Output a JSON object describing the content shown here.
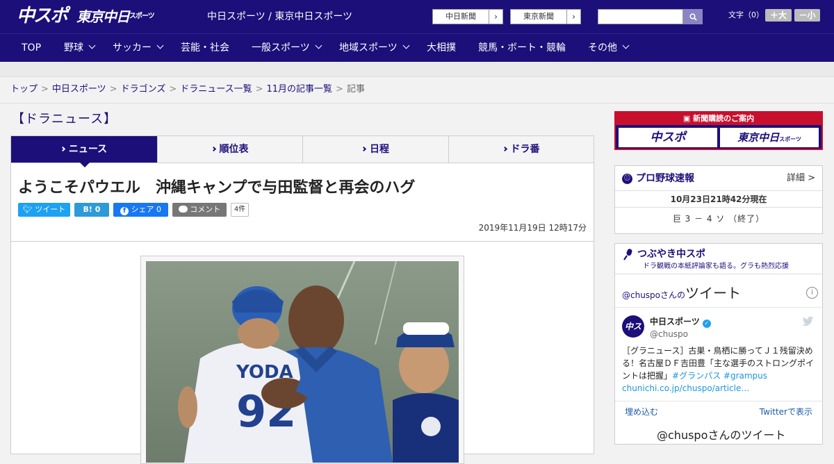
{
  "header": {
    "logo_main": "中スポ",
    "logo_tokyo": "東京中日",
    "logo_tokyo_sub": "スポーツ",
    "site_title": "中日スポーツ / 東京中日スポーツ",
    "link_chunichi": "中日新聞",
    "link_tokyo": "東京新聞",
    "search_placeholder": "",
    "font_size_label": "文字（0）",
    "font_larger": "＋大",
    "font_smaller": "－小"
  },
  "nav": {
    "items": [
      {
        "label": "TOP",
        "has_menu": false
      },
      {
        "label": "野球",
        "has_menu": true
      },
      {
        "label": "サッカー",
        "has_menu": true
      },
      {
        "label": "芸能・社会",
        "has_menu": false
      },
      {
        "label": "一般スポーツ",
        "has_menu": true
      },
      {
        "label": "地域スポーツ",
        "has_menu": true
      },
      {
        "label": "大相撲",
        "has_menu": false
      },
      {
        "label": "競馬・ボート・競輪",
        "has_menu": false
      },
      {
        "label": "その他",
        "has_menu": true
      }
    ]
  },
  "breadcrumb": {
    "items": [
      "トップ",
      "中日スポーツ",
      "ドラゴンズ",
      "ドラニュース一覧",
      "11月の記事一覧"
    ],
    "current": "記事",
    "separator": ">"
  },
  "section_title": "【ドラニュース】",
  "tabs": [
    {
      "label": "ニュース",
      "active": true
    },
    {
      "label": "順位表",
      "active": false
    },
    {
      "label": "日程",
      "active": false
    },
    {
      "label": "ドラ番",
      "active": false
    }
  ],
  "article": {
    "headline": "ようこそパウエル　沖縄キャンプで与田監督と再会のハグ",
    "date": "2019年11月19日 12時17分",
    "share": {
      "tweet": "ツイート",
      "hatena": "B!",
      "hatena_count": "0",
      "facebook": "シェア",
      "facebook_count": "0",
      "comment": "コメント",
      "comment_count": "4件"
    },
    "photo_jersey_name": "YODA",
    "photo_jersey_number": "92"
  },
  "sidebar": {
    "promo_title": "新聞購読のご案内",
    "promo_left": "中スポ",
    "promo_right": "東京中日",
    "promo_right_sub": "スポーツ",
    "score": {
      "title": "プロ野球速報",
      "detail": "詳細 >",
      "time": "10月23日21時42分現在",
      "line": "巨 3 － 4 ソ （終了）"
    },
    "tweets": {
      "title": "つぶやき中スポ",
      "subtitle": "ドラ観戦の本紙評論家も語る。グラも熱烈応援",
      "embed_handle": "@chuspoさんの",
      "embed_word": "ツイート",
      "info": "i",
      "name": "中日スポーツ",
      "handle": "@chuspo",
      "avatar": "中スポ",
      "text_main": "［グラニュース］古巣・鳥栖に勝ってＪ１残留決める！名古屋ＤＦ吉田豊「主な選手のストロングポイントは把握」",
      "hashtag1": "#グランパス",
      "hashtag2": "#grampus",
      "link": "chunichi.co.jp/chuspo/article…",
      "embed_link": "埋め込む",
      "view_link": "Twitterで表示",
      "bottom_title": "@chuspoさんのツイート"
    }
  },
  "colors": {
    "brand": "#1c0f7a",
    "promo_red": "#c8102e",
    "twitter": "#1da1f2"
  }
}
